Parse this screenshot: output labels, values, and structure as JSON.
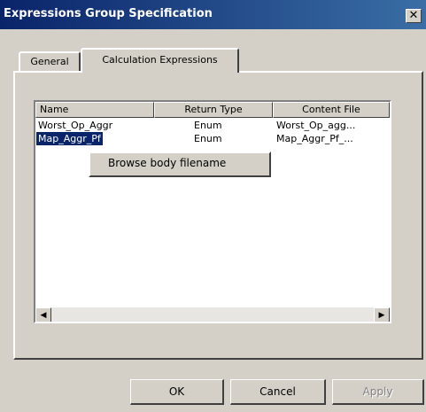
{
  "window": {
    "title": "Expressions Group Specification",
    "close_glyph": "✕"
  },
  "tabs": [
    {
      "label": "General"
    },
    {
      "label": "Calculation Expressions",
      "active": true
    }
  ],
  "table": {
    "columns": [
      "Name",
      "Return Type",
      "Content File"
    ],
    "rows": [
      {
        "name": "Worst_Op_Aggr",
        "return_type": "Enum",
        "content_file": "Worst_Op_agg...",
        "selected": false
      },
      {
        "name": "Map_Aggr_Pf",
        "return_type": "Enum",
        "content_file": "Map_Aggr_Pf_...",
        "selected": true
      }
    ]
  },
  "context_menu": {
    "items": [
      "Browse body filename"
    ]
  },
  "scrollbar": {
    "left_arrow": "◀",
    "right_arrow": "▶"
  },
  "buttons": {
    "ok": "OK",
    "cancel": "Cancel",
    "apply": "Apply"
  }
}
